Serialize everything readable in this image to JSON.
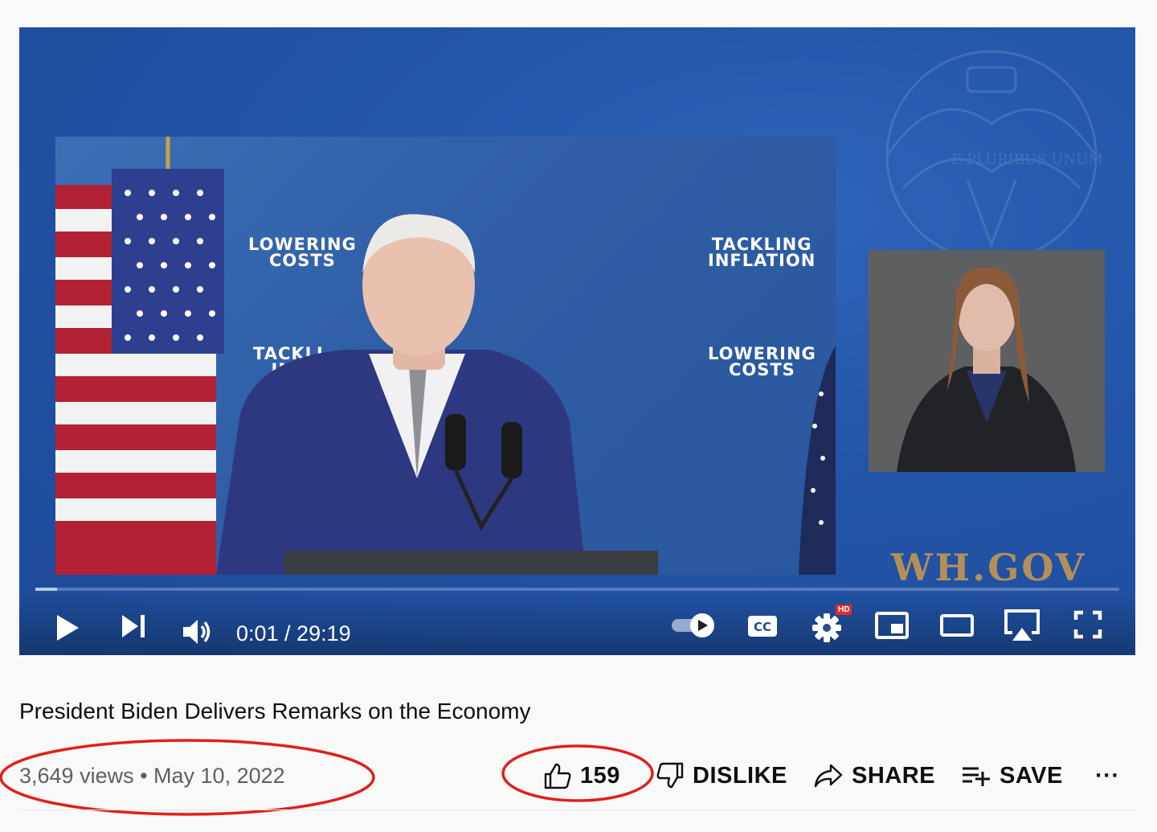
{
  "video": {
    "backdrop_text": "E PLURIBUS UNUM",
    "stage_signs": {
      "top_left_line1": "LOWERING",
      "top_left_line2": "COSTS",
      "top_right_line1": "TACKLING",
      "top_right_line2": "INFLATION",
      "bottom_left_line1": "TACKLI",
      "bottom_left_line2": "INF",
      "bottom_right_line1": "LOWERING",
      "bottom_right_line2": "COSTS"
    },
    "watermark": "WH.GOV",
    "progress_fraction": 0.02
  },
  "controls": {
    "time": "0:01 / 29:19",
    "settings_badge": "HD",
    "icons": [
      "play-icon",
      "next-icon",
      "volume-icon",
      "autoplay-toggle",
      "captions-icon",
      "settings-icon",
      "miniplayer-icon",
      "theater-icon",
      "airplay-icon",
      "fullscreen-icon"
    ]
  },
  "info": {
    "title": "President Biden Delivers Remarks on the Economy",
    "meta": "3,649 views • May 10, 2022"
  },
  "actions": {
    "like_count": "159",
    "dislike_label": "DISLIKE",
    "share_label": "SHARE",
    "save_label": "SAVE",
    "more_label": "···"
  },
  "colors": {
    "annotation": "#e0201b",
    "video_blue": "#2355a8",
    "watermark_gold": "#b58f58"
  }
}
